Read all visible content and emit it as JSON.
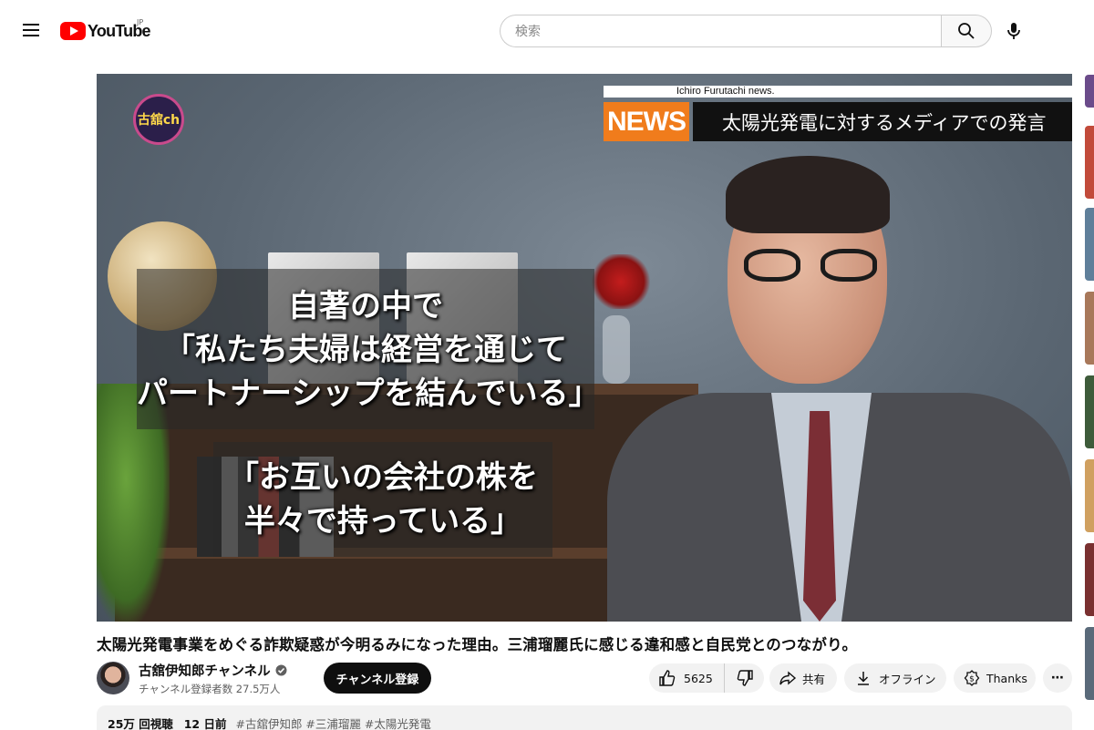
{
  "header": {
    "logo_text": "YouTube",
    "logo_region": "JP",
    "search_placeholder": "検索",
    "icons": [
      "menu-icon",
      "youtube-logo",
      "search-icon",
      "mic-icon"
    ]
  },
  "video": {
    "channel_logo_text": "古舘ch",
    "news_strip_text": "Ichiro Furutachi news.",
    "news_badge": "NEWS",
    "news_title": "太陽光発電に対するメディアでの発言",
    "caption1": [
      "自著の中で",
      "「私たち夫婦は経営を通じて",
      "パートナーシップを結んでいる」"
    ],
    "caption2": [
      "「お互いの会社の株を",
      "半々で持っている」"
    ]
  },
  "title": "太陽光発電事業をめぐる詐欺疑惑が今明るみになった理由。三浦瑠麗氏に感じる違和感と自民党とのつながり。",
  "owner": {
    "channel_name": "古舘伊知郎チャンネル",
    "subscribers": "チャンネル登録者数 27.5万人",
    "subscribe_label": "チャンネル登録"
  },
  "actions": {
    "like_count": "5625",
    "share_label": "共有",
    "offline_label": "オフライン",
    "thanks_label": "Thanks",
    "more_label": "⋯"
  },
  "description": {
    "views": "25万 回視聴",
    "date": "12 日前",
    "tags": "#古舘伊知郎 #三浦瑠麗 #太陽光発電"
  },
  "colors": {
    "brand_red": "#ff0000",
    "news_orange": "#f07c1c",
    "pill_bg": "#f2f2f2"
  }
}
